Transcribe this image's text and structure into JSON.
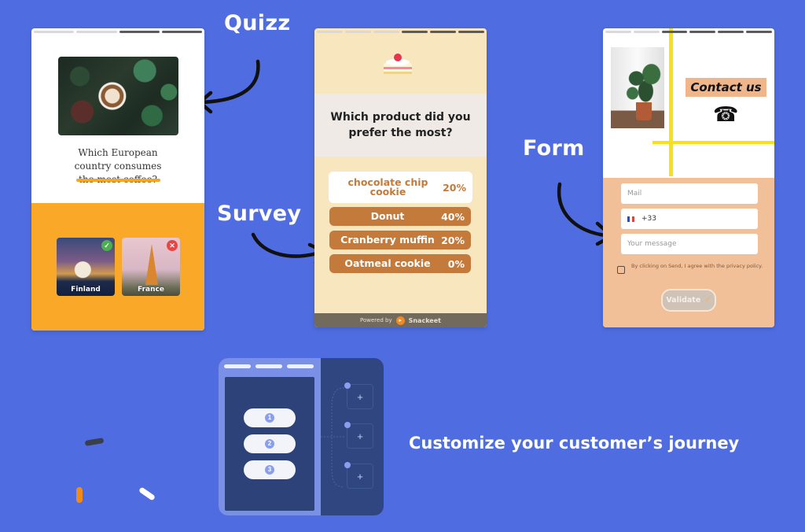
{
  "labels": {
    "quiz": "Quizz",
    "survey": "Survey",
    "form": "Form",
    "tagline": "Customize your customer’s journey"
  },
  "quiz": {
    "progress": [
      "done",
      "done",
      "todo",
      "todo"
    ],
    "image": "coffee-and-plants-photo",
    "question": "Which European country consumes the most coffee?",
    "accent": "#f9a828",
    "answers": [
      {
        "label": "Finland",
        "status": "correct",
        "badge": "✓"
      },
      {
        "label": "France",
        "status": "wrong",
        "badge": "✕"
      }
    ]
  },
  "survey": {
    "progress": [
      "done",
      "done",
      "done",
      "todo",
      "todo",
      "todo"
    ],
    "image": "cake-slice-icon",
    "question": "Which product did you prefer the most?",
    "accent": "#c47a3a",
    "options": [
      {
        "label": "chocolate chip cookie",
        "percent": "20%",
        "selected": true
      },
      {
        "label": "Donut",
        "percent": "40%",
        "selected": false
      },
      {
        "label": "Cranberry muffin",
        "percent": "20%",
        "selected": false
      },
      {
        "label": "Oatmeal cookie",
        "percent": "0%",
        "selected": false
      }
    ],
    "footer": {
      "powered_by": "Powered by",
      "brand": "Snackeet"
    }
  },
  "form": {
    "progress": [
      "done",
      "done",
      "todo",
      "todo",
      "todo",
      "todo"
    ],
    "title": "Contact us",
    "phone_icon": "☎",
    "fields": {
      "mail_placeholder": "Mail",
      "phone_value": "+33",
      "message_placeholder": "Your message"
    },
    "consent_text": "By clicking on Send, I agree with the privacy policy.",
    "consent_checked": false,
    "validate_label": "Validate",
    "validate_icon": "✓",
    "accent": "#f2c098"
  },
  "builder": {
    "steps": [
      "1",
      "2",
      "3"
    ],
    "node_icon": "+"
  }
}
